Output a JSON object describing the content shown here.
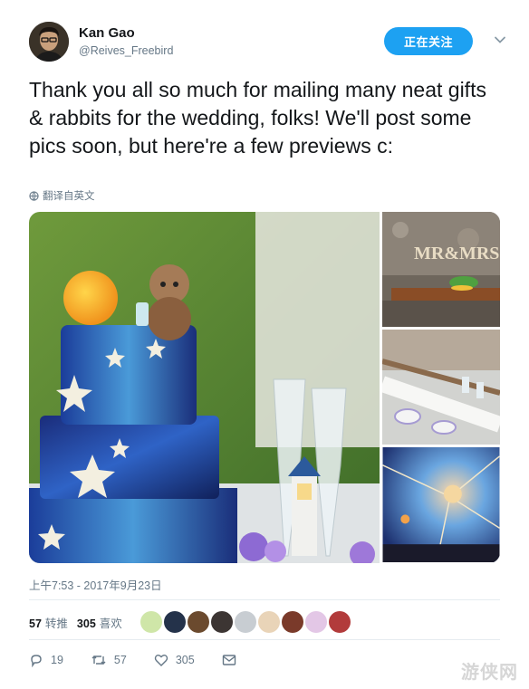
{
  "author": {
    "name": "Kan Gao",
    "handle": "@Reives_Freebird",
    "follow_label": "正在关注"
  },
  "tweet": {
    "text": "Thank you all so much for mailing many neat gifts & rabbits for the wedding, folks! We'll post some pics soon, but here're a few previews c:",
    "translate_label": "翻译自英文",
    "timestamp": "上午7:53 - 2017年9月23日"
  },
  "stats": {
    "retweets_count": "57",
    "retweets_label": "转推",
    "likes_count": "305",
    "likes_label": "喜欢"
  },
  "actions": {
    "reply_count": "19",
    "retweet_count": "57",
    "like_count": "305"
  },
  "watermark": "游侠网",
  "colors": {
    "accent": "#1da1f2",
    "text": "#14171a",
    "muted": "#657786",
    "divider": "#e6ecf0"
  },
  "icons": [
    "chevron-down-icon",
    "globe-icon",
    "reply-icon",
    "retweet-icon",
    "heart-icon",
    "mail-icon"
  ]
}
